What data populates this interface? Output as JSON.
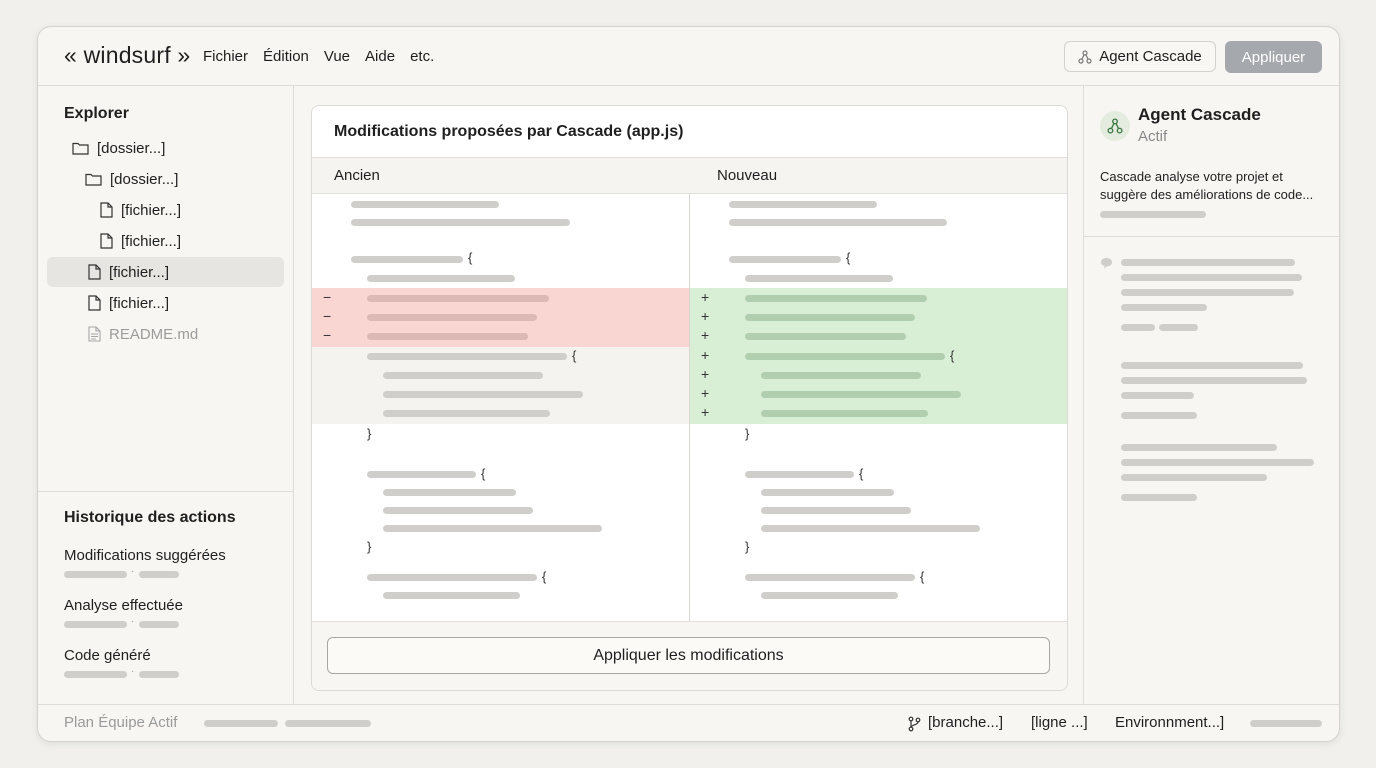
{
  "app": {
    "brand": "« windsurf »"
  },
  "menu": [
    "Fichier",
    "Édition",
    "Vue",
    "Aide",
    "etc."
  ],
  "header": {
    "agent_button": "Agent Cascade",
    "apply_button": "Appliquer"
  },
  "explorer": {
    "title": "Explorer",
    "items": [
      {
        "label": "[dossier...]",
        "type": "folder"
      },
      {
        "label": "[dossier...]",
        "type": "folder"
      },
      {
        "label": "[fichier...]",
        "type": "file"
      },
      {
        "label": "[fichier...]",
        "type": "file"
      },
      {
        "label": "[fichier...]",
        "type": "file",
        "selected": true
      },
      {
        "label": "[fichier...]",
        "type": "file"
      },
      {
        "label": "README.md",
        "type": "file",
        "dimmed": true
      }
    ]
  },
  "history": {
    "title": "Historique des actions",
    "items": [
      "Modifications suggérées",
      "Analyse effectuée",
      "Code généré"
    ],
    "separator": "·"
  },
  "diff": {
    "title": "Modifications proposées par Cascade (app.js)",
    "old_label": "Ancien",
    "new_label": "Nouveau",
    "removed_sign": "−",
    "added_sign": "+",
    "brace_open": "{",
    "brace_close": "}",
    "apply_label": "Appliquer les modifications"
  },
  "agent_panel": {
    "name": "Agent Cascade",
    "status": "Actif",
    "description": "Cascade analyse votre projet et suggère des améliorations de code..."
  },
  "statusbar": {
    "plan": "Plan Équipe Actif",
    "branch": "[branche...]",
    "line": "[ligne ...]",
    "environment": "Environnment...]"
  },
  "colors": {
    "removed_bg": "#f9d6d2",
    "added_bg": "#d8efd6",
    "context_bg": "#f4f3ef",
    "apply_disabled": "#a5a9ae",
    "placeholder": "#cfcecb"
  }
}
